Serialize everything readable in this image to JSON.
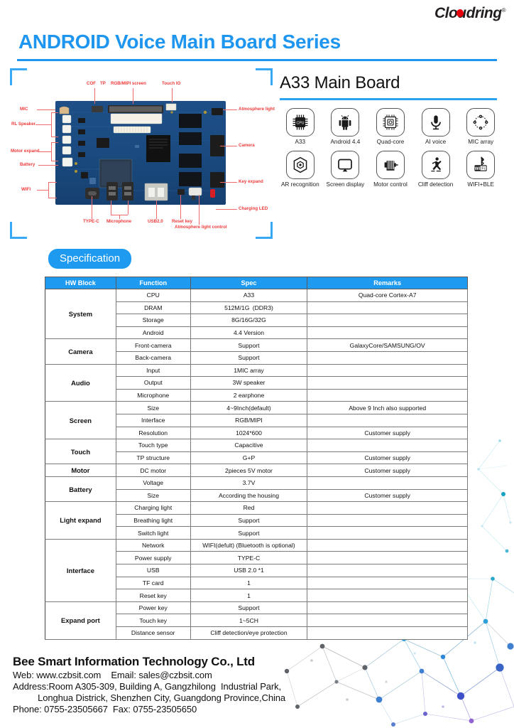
{
  "brand": {
    "logo_text": "Cloudring",
    "logo_mark": "red-dot-o",
    "registered_mark": "®"
  },
  "header": {
    "title": "ANDROID Voice Main Board Series"
  },
  "product": {
    "title": "A33 Main Board",
    "features": [
      {
        "label": "A33",
        "icon": "cpu-chip-icon"
      },
      {
        "label": "Android 4.4",
        "icon": "android-robot-icon"
      },
      {
        "label": "Quad-core",
        "icon": "processor-die-icon"
      },
      {
        "label": "AI voice",
        "icon": "microphone-icon"
      },
      {
        "label": "MIC array",
        "icon": "mic-array-icon"
      },
      {
        "label": "AR recognition",
        "icon": "ar-cube-icon"
      },
      {
        "label": "Screen display",
        "icon": "monitor-icon"
      },
      {
        "label": "Motor control",
        "icon": "motor-icon"
      },
      {
        "label": "Cliff detection",
        "icon": "walking-person-icon"
      },
      {
        "label": "WIFI+BLE",
        "icon": "wifi-bluetooth-icon"
      }
    ]
  },
  "board_diagram": {
    "callouts_top": [
      "COF",
      "TP",
      "RGB/MIPI screen",
      "Touch IO"
    ],
    "callouts_left": [
      "MIC",
      "RL Speaker",
      "Motor expand",
      "Battery",
      "WIFI"
    ],
    "callouts_right": [
      "Atmosphere light",
      "Camera",
      "Key expand",
      "Charging LED"
    ],
    "callouts_bottom": [
      "TYPE-C",
      "Microphone",
      "USB2.0",
      "Reset key",
      "Atmosphere light control"
    ]
  },
  "specification": {
    "badge": "Specification",
    "columns": [
      "HW Block",
      "Function",
      "Spec",
      "Remarks"
    ],
    "groups": [
      {
        "block": "System",
        "rows": [
          {
            "function": "CPU",
            "spec": "A33",
            "remarks": "Quad-core Cortex-A7"
          },
          {
            "function": "DRAM",
            "spec": "512M/1G (DDR3)",
            "remarks": ""
          },
          {
            "function": "Storage",
            "spec": "8G/16G/32G",
            "remarks": ""
          },
          {
            "function": "Android",
            "spec": "4.4 Version",
            "remarks": ""
          }
        ]
      },
      {
        "block": "Camera",
        "rows": [
          {
            "function": "Front-camera",
            "spec": "Support",
            "remarks": "GalaxyCore/SAMSUNG/OV"
          },
          {
            "function": "Back-camera",
            "spec": "Support",
            "remarks": ""
          }
        ]
      },
      {
        "block": "Audio",
        "rows": [
          {
            "function": "Input",
            "spec": "1MIC array",
            "remarks": ""
          },
          {
            "function": "Output",
            "spec": "3W speaker",
            "remarks": ""
          },
          {
            "function": "Microphone",
            "spec": "2 earphone",
            "remarks": ""
          }
        ]
      },
      {
        "block": "Screen",
        "rows": [
          {
            "function": "Size",
            "spec": "4~9Inch(default)",
            "remarks": "Above 9 Inch also supported"
          },
          {
            "function": "Interface",
            "spec": "RGB/MIPI",
            "remarks": ""
          },
          {
            "function": "Resolution",
            "spec": "1024*600",
            "remarks": "Customer supply"
          }
        ]
      },
      {
        "block": "Touch",
        "rows": [
          {
            "function": "Touch type",
            "spec": "Capacitive",
            "remarks": ""
          },
          {
            "function": "TP structure",
            "spec": "G+P",
            "remarks": "Customer supply"
          }
        ]
      },
      {
        "block": "Motor",
        "rows": [
          {
            "function": "DC motor",
            "spec": "2pieces 5V motor",
            "remarks": "Customer supply"
          }
        ]
      },
      {
        "block": "Battery",
        "rows": [
          {
            "function": "Voltage",
            "spec": "3.7V",
            "remarks": ""
          },
          {
            "function": "Size",
            "spec": "According the housing",
            "remarks": "Customer supply"
          }
        ]
      },
      {
        "block": "Light expand",
        "rows": [
          {
            "function": "Charging light",
            "spec": "Red",
            "remarks": ""
          },
          {
            "function": "Breathing light",
            "spec": "Support",
            "remarks": ""
          },
          {
            "function": "Switch light",
            "spec": "Support",
            "remarks": ""
          }
        ]
      },
      {
        "block": "Interface",
        "rows": [
          {
            "function": "Network",
            "spec": "WIFI(defult) (Bluetooth is optional)",
            "remarks": ""
          },
          {
            "function": "Power supply",
            "spec": "TYPE-C",
            "remarks": ""
          },
          {
            "function": "USB",
            "spec": "USB 2.0 *1",
            "remarks": ""
          },
          {
            "function": "TF card",
            "spec": "1",
            "remarks": ""
          },
          {
            "function": "Reset key",
            "spec": "1",
            "remarks": ""
          }
        ]
      },
      {
        "block": "Expand port",
        "rows": [
          {
            "function": "Power key",
            "spec": "Support",
            "remarks": ""
          },
          {
            "function": "Touch key",
            "spec": "1~5CH",
            "remarks": ""
          },
          {
            "function": "Distance sensor",
            "spec": "Cliff detection/eye protection",
            "remarks": ""
          }
        ]
      }
    ]
  },
  "footer": {
    "company": "Bee Smart Information Technology Co., Ltd",
    "web_email": "Web: www.czbsit.com    Email: sales@czbsit.com",
    "address_line1": "Address:Room A305-309, Building A, Gangzhilong  Industrial Park,",
    "address_line2": "          Longhua Districk, Shenzhen City, Guangdong Province,China",
    "phone_fax": "Phone: 0755-23505667  Fax: 0755-23505650"
  },
  "colors": {
    "brand_blue": "#1e9bf0",
    "title_blue": "#1e96f0",
    "callout_red": "#ef3b3b",
    "logo_red": "#e3000b"
  }
}
